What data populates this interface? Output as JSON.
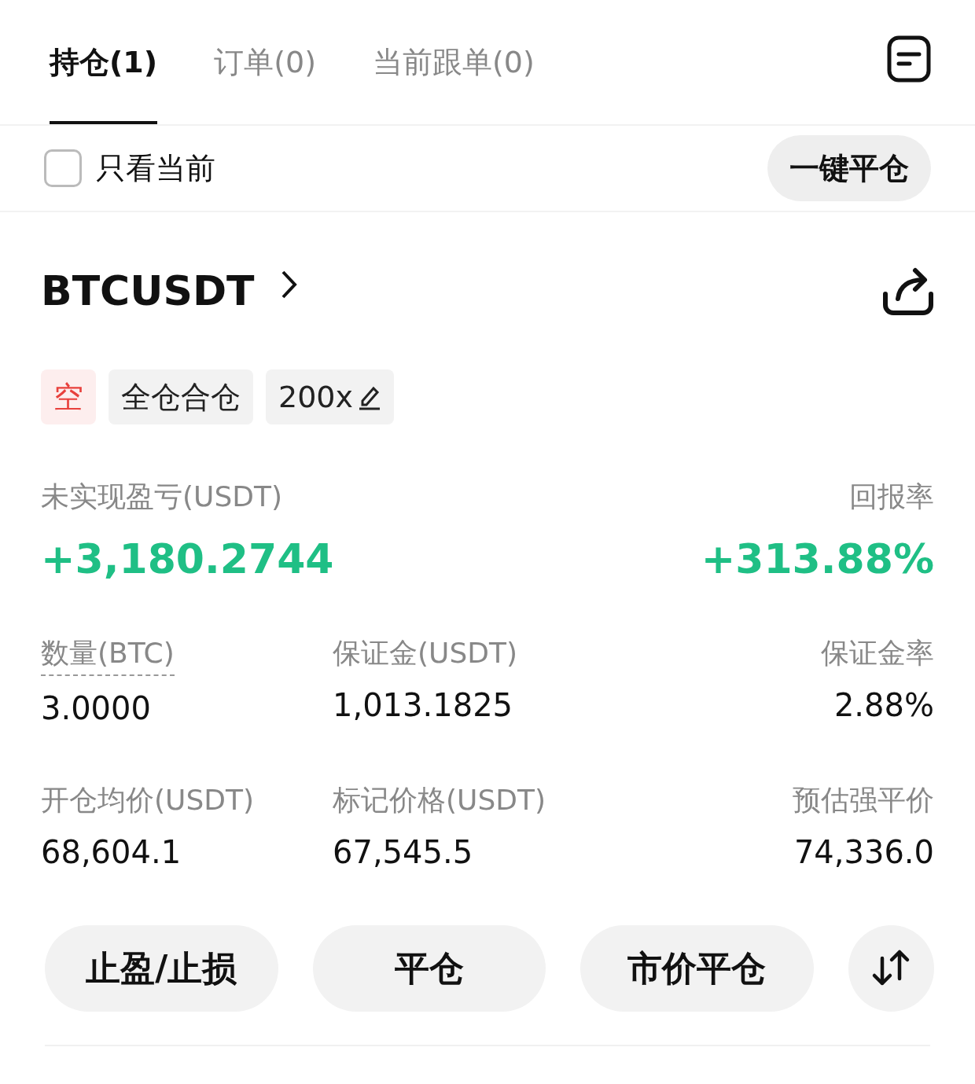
{
  "tabs": [
    {
      "label": "持仓(1)",
      "selected": true
    },
    {
      "label": "订单(0)",
      "selected": false
    },
    {
      "label": "当前跟单(0)",
      "selected": false
    }
  ],
  "filter": {
    "label": "只看当前",
    "checked": false
  },
  "close_all_button": "一键平仓",
  "position": {
    "symbol": "BTCUSDT",
    "tags": [
      {
        "kind": "side",
        "label": "空"
      },
      {
        "kind": "plain",
        "label": "全仓合仓"
      },
      {
        "kind": "leverage",
        "label": "200x"
      }
    ],
    "pnl": {
      "label": "未实现盈亏(USDT)",
      "value": "+3,180.2744",
      "kind": "gain"
    },
    "roe": {
      "label": "回报率",
      "value": "+313.88%",
      "kind": "gain"
    },
    "stats": [
      {
        "label": "数量(BTC)",
        "value": "3.0000",
        "dashed_underline": true
      },
      {
        "label": "保证金(USDT)",
        "value": "1,013.1825",
        "dashed_underline": false
      },
      {
        "label": "保证金率",
        "value": "2.88%",
        "dashed_underline": false
      },
      {
        "label": "开仓均价(USDT)",
        "value": "68,604.1",
        "dashed_underline": false
      },
      {
        "label": "标记价格(USDT)",
        "value": "67,545.5",
        "dashed_underline": false
      },
      {
        "label": "预估强平价",
        "value": "74,336.0",
        "dashed_underline": false
      }
    ],
    "actions": [
      "止盈/止损",
      "平仓",
      "市价平仓"
    ]
  }
}
